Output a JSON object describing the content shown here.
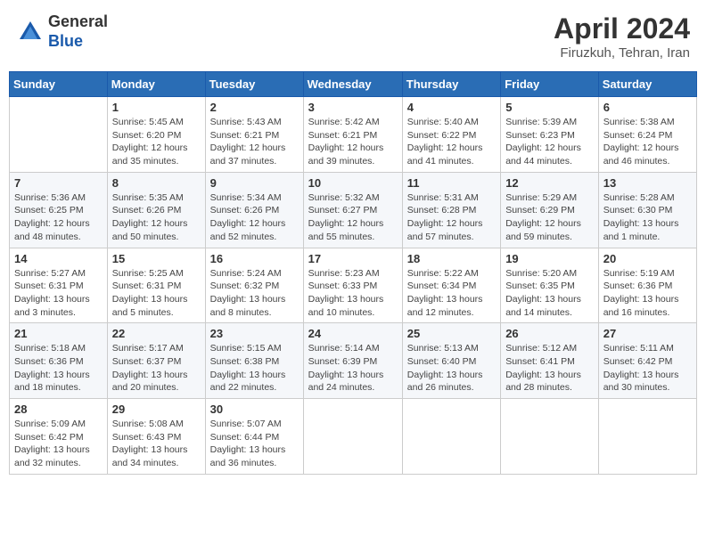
{
  "header": {
    "logo_line1": "General",
    "logo_line2": "Blue",
    "month_title": "April 2024",
    "location": "Firuzkuh, Tehran, Iran"
  },
  "weekdays": [
    "Sunday",
    "Monday",
    "Tuesday",
    "Wednesday",
    "Thursday",
    "Friday",
    "Saturday"
  ],
  "weeks": [
    [
      {
        "day": "",
        "info": ""
      },
      {
        "day": "1",
        "info": "Sunrise: 5:45 AM\nSunset: 6:20 PM\nDaylight: 12 hours\nand 35 minutes."
      },
      {
        "day": "2",
        "info": "Sunrise: 5:43 AM\nSunset: 6:21 PM\nDaylight: 12 hours\nand 37 minutes."
      },
      {
        "day": "3",
        "info": "Sunrise: 5:42 AM\nSunset: 6:21 PM\nDaylight: 12 hours\nand 39 minutes."
      },
      {
        "day": "4",
        "info": "Sunrise: 5:40 AM\nSunset: 6:22 PM\nDaylight: 12 hours\nand 41 minutes."
      },
      {
        "day": "5",
        "info": "Sunrise: 5:39 AM\nSunset: 6:23 PM\nDaylight: 12 hours\nand 44 minutes."
      },
      {
        "day": "6",
        "info": "Sunrise: 5:38 AM\nSunset: 6:24 PM\nDaylight: 12 hours\nand 46 minutes."
      }
    ],
    [
      {
        "day": "7",
        "info": "Sunrise: 5:36 AM\nSunset: 6:25 PM\nDaylight: 12 hours\nand 48 minutes."
      },
      {
        "day": "8",
        "info": "Sunrise: 5:35 AM\nSunset: 6:26 PM\nDaylight: 12 hours\nand 50 minutes."
      },
      {
        "day": "9",
        "info": "Sunrise: 5:34 AM\nSunset: 6:26 PM\nDaylight: 12 hours\nand 52 minutes."
      },
      {
        "day": "10",
        "info": "Sunrise: 5:32 AM\nSunset: 6:27 PM\nDaylight: 12 hours\nand 55 minutes."
      },
      {
        "day": "11",
        "info": "Sunrise: 5:31 AM\nSunset: 6:28 PM\nDaylight: 12 hours\nand 57 minutes."
      },
      {
        "day": "12",
        "info": "Sunrise: 5:29 AM\nSunset: 6:29 PM\nDaylight: 12 hours\nand 59 minutes."
      },
      {
        "day": "13",
        "info": "Sunrise: 5:28 AM\nSunset: 6:30 PM\nDaylight: 13 hours\nand 1 minute."
      }
    ],
    [
      {
        "day": "14",
        "info": "Sunrise: 5:27 AM\nSunset: 6:31 PM\nDaylight: 13 hours\nand 3 minutes."
      },
      {
        "day": "15",
        "info": "Sunrise: 5:25 AM\nSunset: 6:31 PM\nDaylight: 13 hours\nand 5 minutes."
      },
      {
        "day": "16",
        "info": "Sunrise: 5:24 AM\nSunset: 6:32 PM\nDaylight: 13 hours\nand 8 minutes."
      },
      {
        "day": "17",
        "info": "Sunrise: 5:23 AM\nSunset: 6:33 PM\nDaylight: 13 hours\nand 10 minutes."
      },
      {
        "day": "18",
        "info": "Sunrise: 5:22 AM\nSunset: 6:34 PM\nDaylight: 13 hours\nand 12 minutes."
      },
      {
        "day": "19",
        "info": "Sunrise: 5:20 AM\nSunset: 6:35 PM\nDaylight: 13 hours\nand 14 minutes."
      },
      {
        "day": "20",
        "info": "Sunrise: 5:19 AM\nSunset: 6:36 PM\nDaylight: 13 hours\nand 16 minutes."
      }
    ],
    [
      {
        "day": "21",
        "info": "Sunrise: 5:18 AM\nSunset: 6:36 PM\nDaylight: 13 hours\nand 18 minutes."
      },
      {
        "day": "22",
        "info": "Sunrise: 5:17 AM\nSunset: 6:37 PM\nDaylight: 13 hours\nand 20 minutes."
      },
      {
        "day": "23",
        "info": "Sunrise: 5:15 AM\nSunset: 6:38 PM\nDaylight: 13 hours\nand 22 minutes."
      },
      {
        "day": "24",
        "info": "Sunrise: 5:14 AM\nSunset: 6:39 PM\nDaylight: 13 hours\nand 24 minutes."
      },
      {
        "day": "25",
        "info": "Sunrise: 5:13 AM\nSunset: 6:40 PM\nDaylight: 13 hours\nand 26 minutes."
      },
      {
        "day": "26",
        "info": "Sunrise: 5:12 AM\nSunset: 6:41 PM\nDaylight: 13 hours\nand 28 minutes."
      },
      {
        "day": "27",
        "info": "Sunrise: 5:11 AM\nSunset: 6:42 PM\nDaylight: 13 hours\nand 30 minutes."
      }
    ],
    [
      {
        "day": "28",
        "info": "Sunrise: 5:09 AM\nSunset: 6:42 PM\nDaylight: 13 hours\nand 32 minutes."
      },
      {
        "day": "29",
        "info": "Sunrise: 5:08 AM\nSunset: 6:43 PM\nDaylight: 13 hours\nand 34 minutes."
      },
      {
        "day": "30",
        "info": "Sunrise: 5:07 AM\nSunset: 6:44 PM\nDaylight: 13 hours\nand 36 minutes."
      },
      {
        "day": "",
        "info": ""
      },
      {
        "day": "",
        "info": ""
      },
      {
        "day": "",
        "info": ""
      },
      {
        "day": "",
        "info": ""
      }
    ]
  ]
}
